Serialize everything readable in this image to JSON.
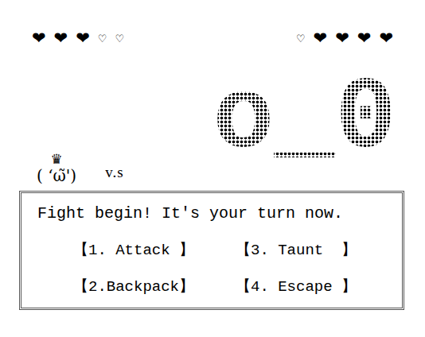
{
  "player": {
    "hearts": [
      {
        "glyph": "❤",
        "filled": true
      },
      {
        "glyph": "❤",
        "filled": true
      },
      {
        "glyph": "❤",
        "filled": true
      },
      {
        "glyph": "♡",
        "filled": false
      },
      {
        "glyph": "♡",
        "filled": false
      }
    ],
    "crown": "♛",
    "face": "( ‘ω̃')"
  },
  "versus": "v.s",
  "enemy": {
    "hearts": [
      {
        "glyph": "♡",
        "filled": false
      },
      {
        "glyph": "❤",
        "filled": true
      },
      {
        "glyph": "❤",
        "filled": true
      },
      {
        "glyph": "❤",
        "filled": true
      },
      {
        "glyph": "❤",
        "filled": true
      }
    ],
    "face": "o_0"
  },
  "dialog": {
    "message": "Fight begin! It's your turn now.",
    "options": [
      {
        "label": "【1. Attack 】"
      },
      {
        "label": "【3. Taunt  】"
      },
      {
        "label": "【2.Backpack】"
      },
      {
        "label": "【4. Escape 】"
      }
    ]
  }
}
